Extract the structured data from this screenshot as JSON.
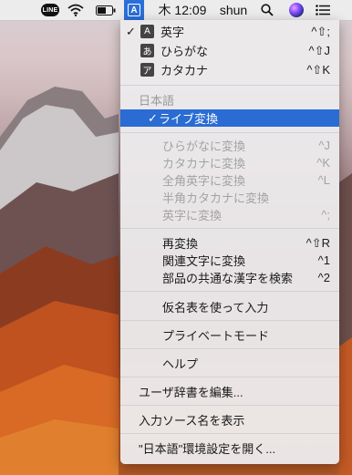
{
  "menubar": {
    "line_label": "LINE",
    "input_indicator": "A",
    "clock": "木 12:09",
    "user": "shun"
  },
  "menu": {
    "modes": [
      {
        "check": "✓",
        "badge": "A",
        "label": "英字",
        "shortcut": "^⇧;"
      },
      {
        "check": "",
        "badge": "あ",
        "label": "ひらがな",
        "shortcut": "^⇧J"
      },
      {
        "check": "",
        "badge": "ア",
        "label": "カタカナ",
        "shortcut": "^⇧K"
      }
    ],
    "section_title": "日本語",
    "selected_item": {
      "check": "✓",
      "label": "ライブ変換"
    },
    "convert_items": [
      {
        "label": "ひらがなに変換",
        "shortcut": "^J"
      },
      {
        "label": "カタカナに変換",
        "shortcut": "^K"
      },
      {
        "label": "全角英字に変換",
        "shortcut": "^L"
      },
      {
        "label": "半角カタカナに変換",
        "shortcut": ""
      },
      {
        "label": "英字に変換",
        "shortcut": "^;"
      }
    ],
    "reconvert_items": [
      {
        "label": "再変換",
        "shortcut": "^⇧R"
      },
      {
        "label": "関連文字に変換",
        "shortcut": "^1"
      },
      {
        "label": "部品の共通な漢字を検索",
        "shortcut": "^2"
      }
    ],
    "kana_table": "仮名表を使って入力",
    "private_mode": "プライベートモード",
    "help": "ヘルプ",
    "edit_dictionary": "ユーザ辞書を編集...",
    "show_source_name": "入力ソース名を表示",
    "open_prefs": "\"日本語\"環境設定を開く..."
  },
  "colors": {
    "accent": "#2a6cd3",
    "menubar": "#ececec",
    "disabled_text": "#a3a3a3"
  }
}
